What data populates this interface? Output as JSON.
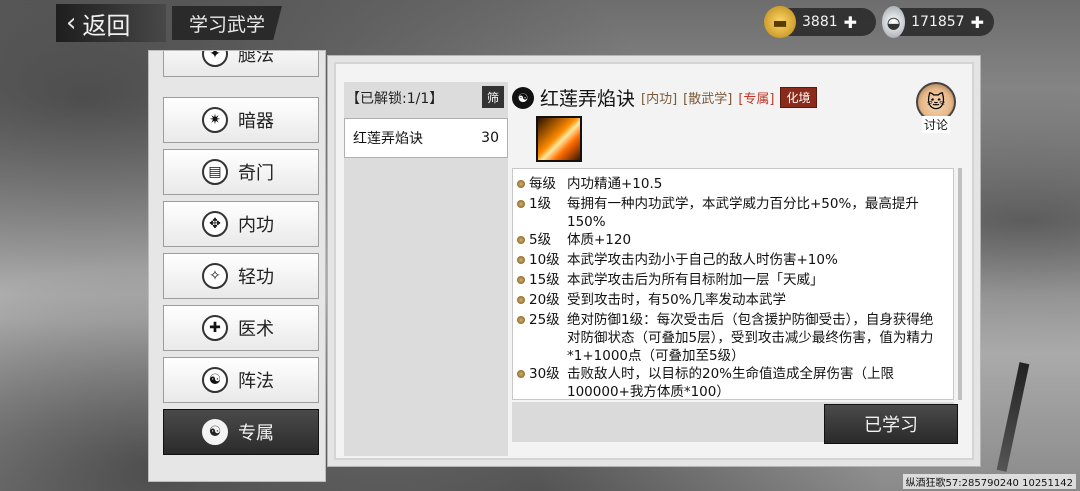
{
  "topbar": {
    "back_label": "返回",
    "page_title": "学习武学",
    "gold": "3881",
    "silver": "171857"
  },
  "categories": [
    {
      "label": "腿法",
      "icon": "leg-icon"
    },
    {
      "label": "暗器",
      "icon": "shuriken-icon"
    },
    {
      "label": "奇门",
      "icon": "scroll-icon"
    },
    {
      "label": "内功",
      "icon": "meditation-icon"
    },
    {
      "label": "轻功",
      "icon": "running-icon"
    },
    {
      "label": "医术",
      "icon": "medical-cross-icon"
    },
    {
      "label": "阵法",
      "icon": "yin-yang-icon"
    },
    {
      "label": "专属",
      "icon": "yin-yang-icon",
      "active": true
    }
  ],
  "list": {
    "unlock_label": "【已解锁:1/1】",
    "filter_label": "筛",
    "skill_name": "红莲弄焰诀",
    "skill_level": "30"
  },
  "skill": {
    "title": "红莲弄焰诀",
    "tag1": "[内功]",
    "tag2": "[散武学]",
    "tag3": "[专属]",
    "realm": "化境",
    "discuss_label": "讨论",
    "learned_label": "已学习"
  },
  "effects": [
    {
      "lvl": "每级",
      "text": "内功精通+10.5"
    },
    {
      "lvl": "1级",
      "text": "每拥有一种内功武学，本武学威力百分比+50%，最高提升150%"
    },
    {
      "lvl": "5级",
      "text": "体质+120"
    },
    {
      "lvl": "10级",
      "text": "本武学攻击内劲小于自己的敌人时伤害+10%"
    },
    {
      "lvl": "15级",
      "text": "本武学攻击后为所有目标附加一层「天威」"
    },
    {
      "lvl": "20级",
      "text": "受到攻击时，有50%几率发动本武学"
    },
    {
      "lvl": "25级",
      "text": "绝对防御1级：每次受击后（包含援护防御受击），自身获得绝对防御状态（可叠加5层），受到攻击减少最终伤害，值为精力*1+1000点（可叠加至5级）"
    },
    {
      "lvl": "30级",
      "text": "击败敌人时，以目标的20%生命值造成全屏伤害（上限100000+我方体质*100）"
    }
  ],
  "footer": {
    "id_text": "纵酒狂歌57:285790240  10251142"
  },
  "colors": {
    "realm_bg": "#8a2b1c",
    "tag_red": "#c0392b",
    "dark_button": "#2a2a2a"
  }
}
